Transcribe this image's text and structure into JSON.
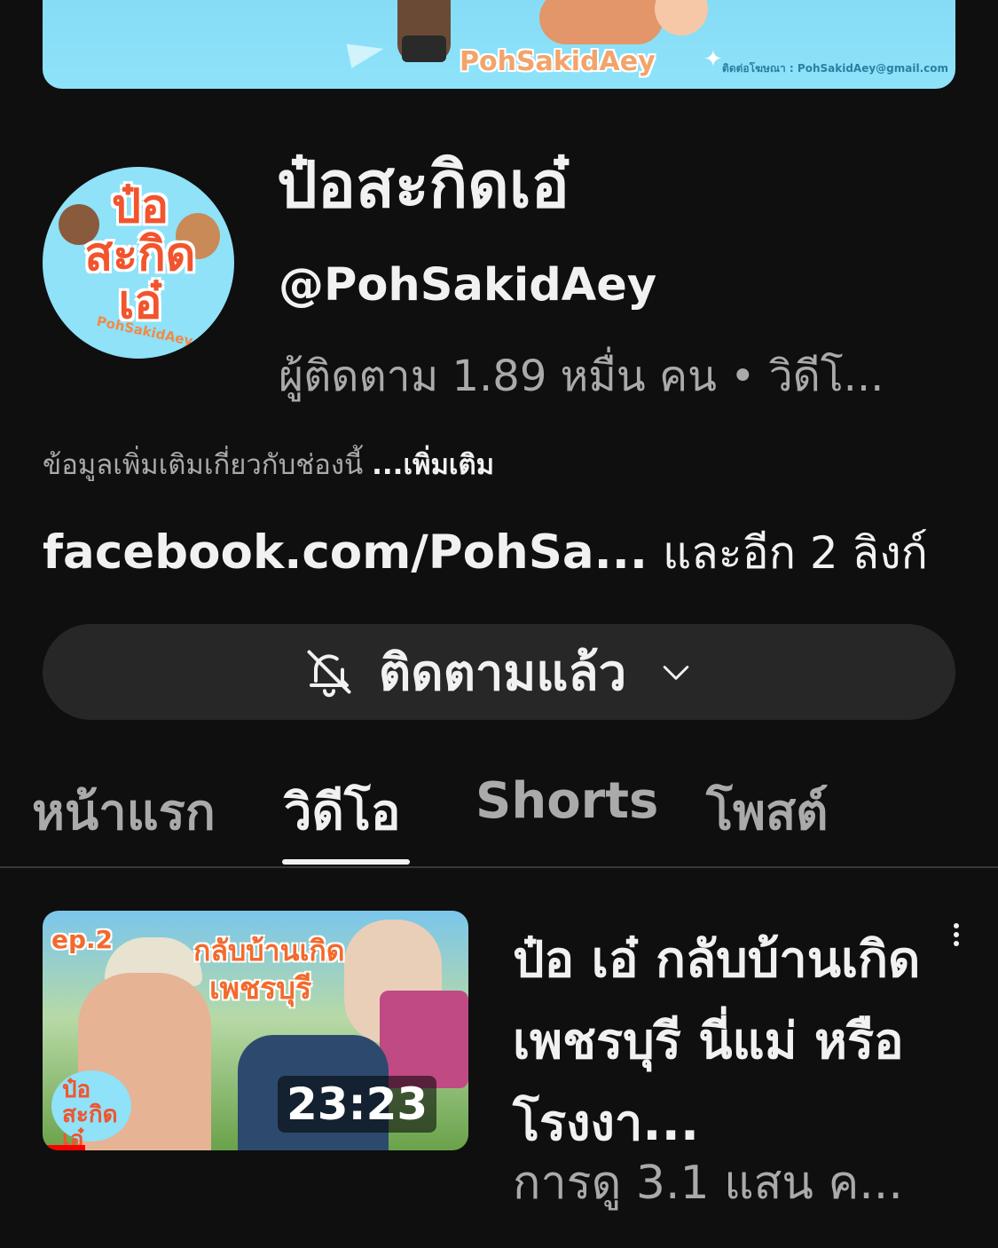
{
  "banner": {
    "brand_text": "PohSakidAey",
    "contact_text": "ติดต่อโฆษณา : PohSakidAey@gmail.com"
  },
  "avatar": {
    "logo_text": "ป๋อ สะกิด เอ๋",
    "ring_text": "PohSakidAey"
  },
  "channel": {
    "name": "ป๋อสะกิดเอ๋",
    "handle": "@PohSakidAey",
    "stats": "ผู้ติดตาม 1.89 หมื่น คน • วิดีโ...",
    "about_text": "ข้อมูลเพิ่มเติมเกี่ยวกับช่องนี้",
    "about_more": "...เพิ่มเติม",
    "link_url": "facebook.com/PohSa...",
    "link_extra": "และอีก 2 ลิงก์"
  },
  "subscribe": {
    "label": "ติดตามแล้ว",
    "bell_icon": "bell-off-icon",
    "chevron_icon": "chevron-down-icon"
  },
  "tabs": [
    {
      "label": "หน้าแรก",
      "active": false
    },
    {
      "label": "วิดีโอ",
      "active": true
    },
    {
      "label": "Shorts",
      "active": false
    },
    {
      "label": "โพสต์",
      "active": false
    }
  ],
  "video": {
    "thumb_ep": "ep.2",
    "thumb_title_1": "กลับบ้านเกิด",
    "thumb_title_2": "เพชรบุรี",
    "thumb_logo": "ป๋อ สะกิด เอ๋",
    "duration": "23:23",
    "progress_fraction": 0.1,
    "title": "ป๋อ เอ๋ กลับบ้านเกิดเพชรบุรี นี่แม่ หรือโรงงา...",
    "meta": "การดู 3.1 แสน ค..."
  }
}
